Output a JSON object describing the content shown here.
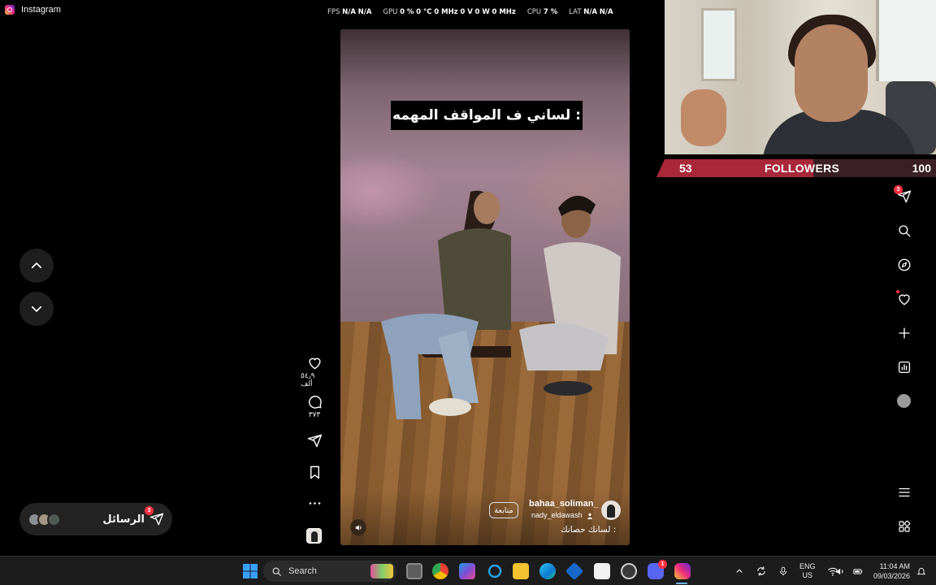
{
  "window": {
    "title": "Instagram"
  },
  "overlay_stats": {
    "fps_label": "FPS",
    "fps_value": "N/A",
    "fps_value2": "N/A",
    "gpu_label": "GPU",
    "gpu_usage": "0 %",
    "gpu_temp": "0 °C",
    "gpu_clock": "0 MHz",
    "gpu_volt": "0 V",
    "gpu_power": "0 W",
    "gpu_mem_clock": "0 MHz",
    "cpu_label": "CPU",
    "cpu_usage": "7 %",
    "lat_label": "LAT",
    "lat_value": "N/A",
    "lat_value2": "N/A"
  },
  "reel": {
    "caption_overlay": "لساني ف المواقف المهمه :",
    "author": "bahaa_soliman_",
    "collaborator": "nady_eldawash",
    "follow_label": "متابعة",
    "text": "لسانك حصانك :"
  },
  "actions": {
    "likes": "٥٤٫٩ ألف",
    "comments": "٣٧٣"
  },
  "messages": {
    "label": "الرسائل",
    "badge": "3"
  },
  "followers_widget": {
    "current": "53",
    "label": "FOLLOWERS",
    "goal": "100",
    "progress_fraction": 0.53
  },
  "right_rail": {
    "messages_badge": "3"
  },
  "taskbar": {
    "search_placeholder": "Search",
    "lang_line1": "ENG",
    "lang_line2": "US",
    "time": "11:04 AM",
    "date": "09/03/2026",
    "discord_badge": "1"
  },
  "colors": {
    "follower_bar": "#a8283a",
    "badge": "#ff3040",
    "taskbar": "#1c1c1c"
  }
}
